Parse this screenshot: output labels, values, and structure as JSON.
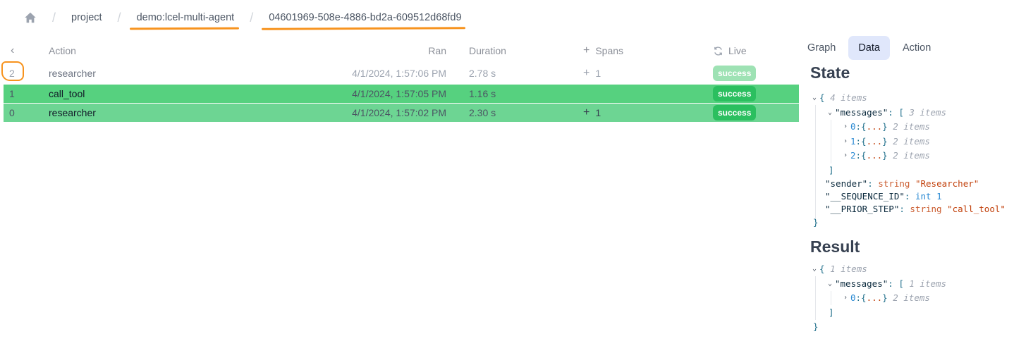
{
  "breadcrumb": {
    "home_icon": "home-icon",
    "items": [
      "project",
      "demo:lcel-multi-agent",
      "04601969-508e-4886-bd2a-609512d68fd9"
    ],
    "separator": "/"
  },
  "table": {
    "back_icon": "chevron-left-icon",
    "headers": {
      "action": "Action",
      "ran": "Ran",
      "duration": "Duration",
      "spans": "Spans",
      "live": "Live"
    },
    "rows": [
      {
        "index": "2",
        "action": "researcher",
        "ran": "4/1/2024, 1:57:06 PM",
        "duration": "2.78 s",
        "spans": "1",
        "status": "success"
      },
      {
        "index": "1",
        "action": "call_tool",
        "ran": "4/1/2024, 1:57:05 PM",
        "duration": "1.16 s",
        "spans": "",
        "status": "success"
      },
      {
        "index": "0",
        "action": "researcher",
        "ran": "4/1/2024, 1:57:02 PM",
        "duration": "2.30 s",
        "spans": "1",
        "status": "success"
      }
    ]
  },
  "tabs": [
    "Graph",
    "Data",
    "Action"
  ],
  "active_tab": "Data",
  "state": {
    "title": "State",
    "root_count": "4 items",
    "messages_key": "\"messages\"",
    "messages_count": "3 items",
    "message_items": [
      {
        "index": "0",
        "count": "2 items"
      },
      {
        "index": "1",
        "count": "2 items"
      },
      {
        "index": "2",
        "count": "2 items"
      }
    ],
    "fields": [
      {
        "key": "\"sender\"",
        "type": "string",
        "value": "\"Researcher\""
      },
      {
        "key": "\"__SEQUENCE_ID\"",
        "type": "int",
        "value": "1"
      },
      {
        "key": "\"__PRIOR_STEP\"",
        "type": "string",
        "value": "\"call_tool\""
      }
    ]
  },
  "result": {
    "title": "Result",
    "root_count": "1 items",
    "messages_key": "\"messages\"",
    "messages_count": "1 items",
    "message_items": [
      {
        "index": "0",
        "count": "2 items"
      }
    ]
  },
  "colors": {
    "annotation": "#f7931e",
    "selected_row": "#56d17f",
    "row_highlight": "#6dd593",
    "success_badge": "#2bbf5f",
    "active_tab_bg": "#e0e7fb"
  }
}
